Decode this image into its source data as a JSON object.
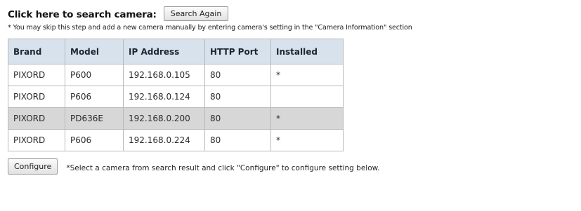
{
  "search": {
    "title": "Click here to search camera:",
    "button_label": "Search Again",
    "hint": "* You may skip this step and add a new camera manually by entering camera's setting in the \"Camera Information\" section"
  },
  "table": {
    "headers": [
      "Brand",
      "Model",
      "IP Address",
      "HTTP Port",
      "Installed"
    ],
    "rows": [
      {
        "brand": "PIXORD",
        "model": "P600",
        "ip": "192.168.0.105",
        "port": "80",
        "installed": "*",
        "selected": false
      },
      {
        "brand": "PIXORD",
        "model": "P606",
        "ip": "192.168.0.124",
        "port": "80",
        "installed": "",
        "selected": false
      },
      {
        "brand": "PIXORD",
        "model": "PD636E",
        "ip": "192.168.0.200",
        "port": "80",
        "installed": "*",
        "selected": true
      },
      {
        "brand": "PIXORD",
        "model": "P606",
        "ip": "192.168.0.224",
        "port": "80",
        "installed": "*",
        "selected": false
      }
    ]
  },
  "configure": {
    "button_label": "Configure",
    "note": "*Select a camera from search result and click \"Configure\" to configure setting below."
  },
  "colors": {
    "header_bg": "#d8e2ec",
    "selected_row_bg": "#d7d7d7",
    "border": "#b9b9b9"
  }
}
